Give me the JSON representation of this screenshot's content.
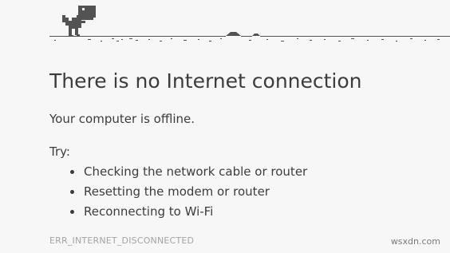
{
  "error_page": {
    "title": "There is no Internet connection",
    "subtitle": "Your computer is offline.",
    "try_label": "Try:",
    "suggestions": [
      "Checking the network cable or router",
      "Resetting the modem or router",
      "Reconnecting to Wi-Fi"
    ],
    "error_code": "ERR_INTERNET_DISCONNECTED"
  },
  "game": {
    "character_icon": "t-rex-dinosaur-icon",
    "ground_icon": "desert-ground-line"
  },
  "watermark": "wsxdn.com",
  "colors": {
    "background": "#f7f7f7",
    "text": "#3c3c3c",
    "error_code": "#a4a4a4",
    "dino": "#535353"
  }
}
